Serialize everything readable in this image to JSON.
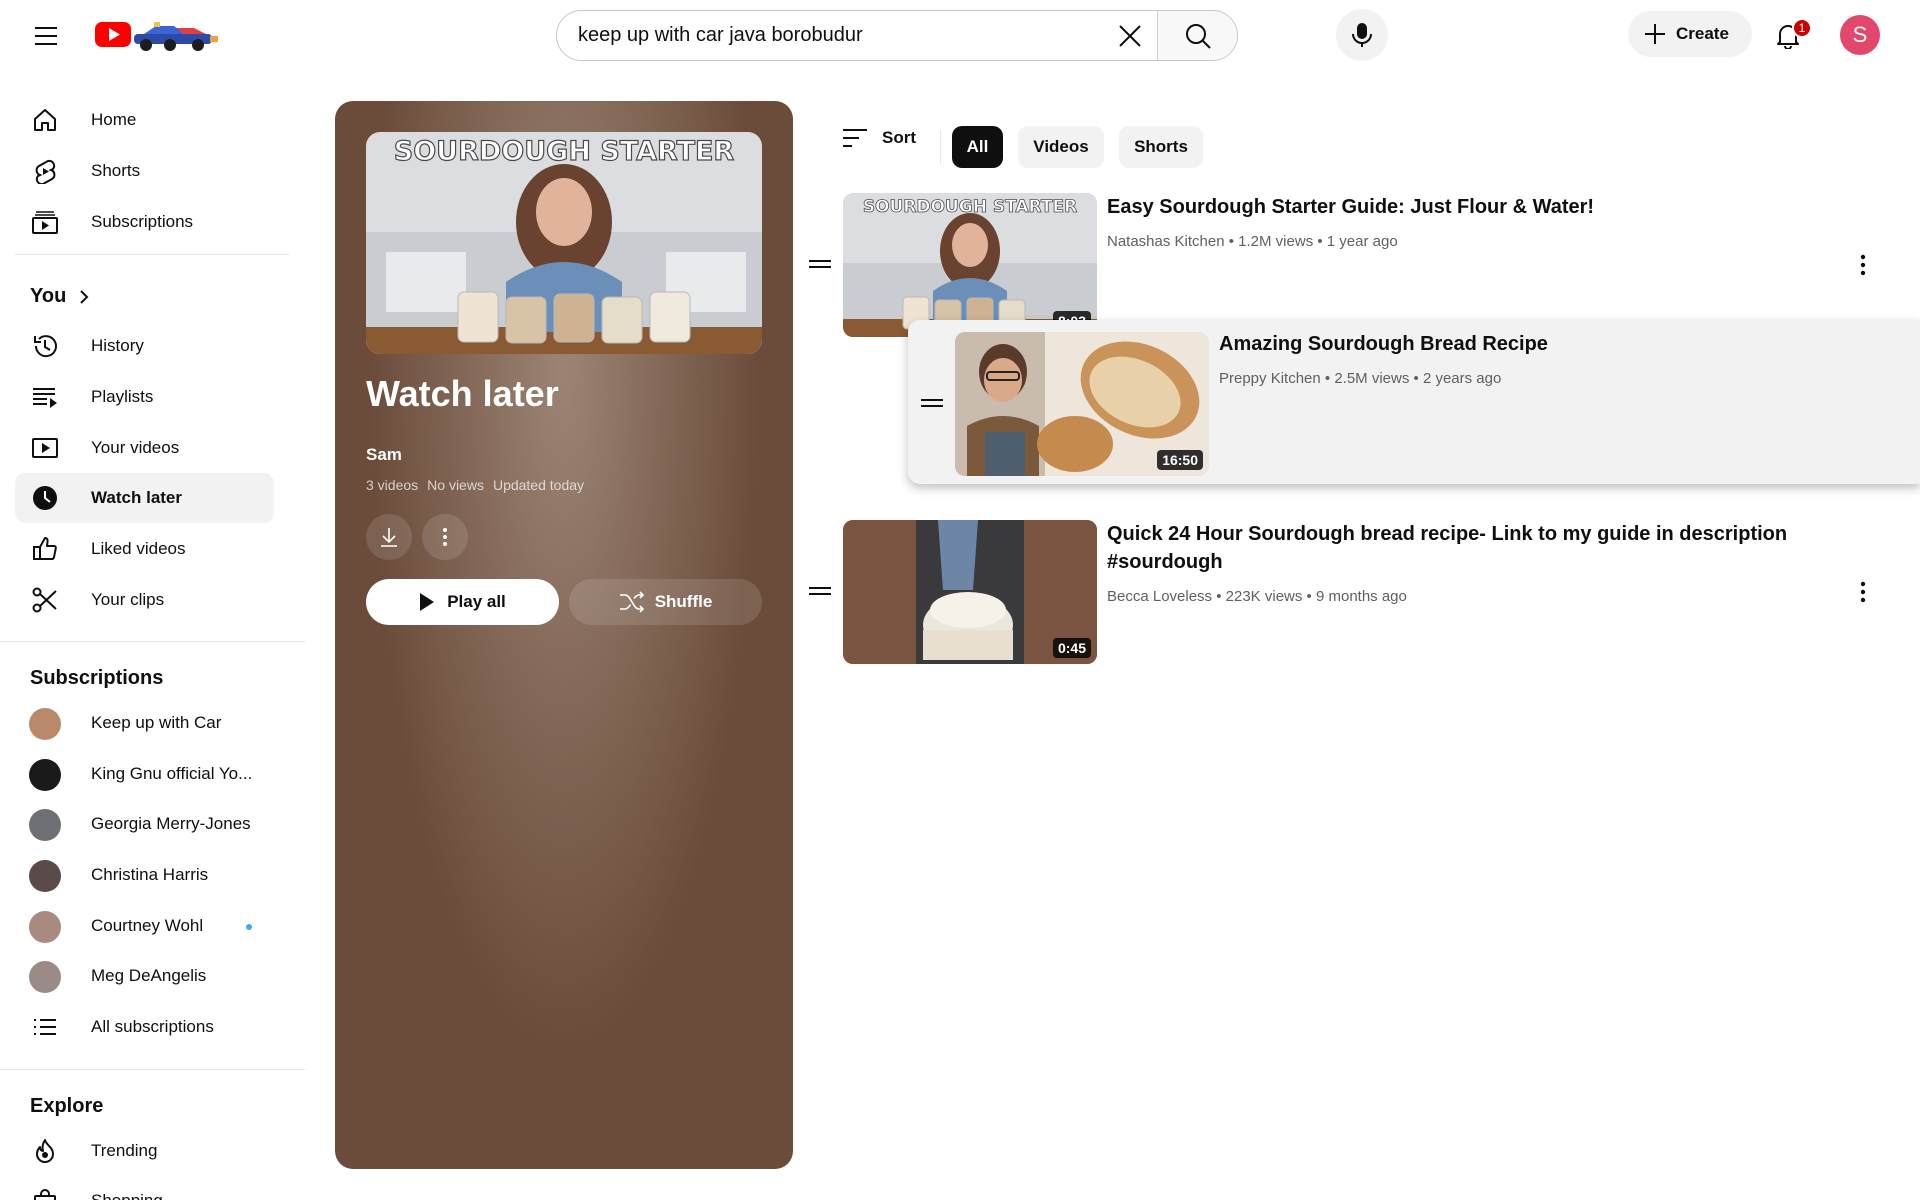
{
  "masthead": {
    "search_value": "keep up with car java borobudur",
    "create_label": "Create",
    "notification_count": "1",
    "avatar_letter": "S"
  },
  "sidebar": {
    "main": [
      {
        "label": "Home",
        "icon": "home-icon"
      },
      {
        "label": "Shorts",
        "icon": "shorts-icon"
      },
      {
        "label": "Subscriptions",
        "icon": "subscriptions-icon"
      }
    ],
    "you_title": "You",
    "you_items": [
      {
        "label": "History",
        "icon": "history-icon"
      },
      {
        "label": "Playlists",
        "icon": "playlists-icon"
      },
      {
        "label": "Your videos",
        "icon": "your-videos-icon"
      },
      {
        "label": "Watch later",
        "icon": "watch-later-icon",
        "active": true
      },
      {
        "label": "Liked videos",
        "icon": "like-icon"
      },
      {
        "label": "Your clips",
        "icon": "scissors-icon"
      }
    ],
    "subscriptions_title": "Subscriptions",
    "subscriptions": [
      {
        "label": "Keep up with Car",
        "color": "#b98a6a"
      },
      {
        "label": "King Gnu official Yo...",
        "color": "#1a1a1a"
      },
      {
        "label": "Georgia Merry-Jones",
        "color": "#6d6f74"
      },
      {
        "label": "Christina Harris",
        "color": "#5a4a48"
      },
      {
        "label": "Courtney Wohl",
        "color": "#a98a80",
        "new": true
      },
      {
        "label": "Meg DeAngelis",
        "color": "#9b8b86"
      }
    ],
    "all_subscriptions": "All subscriptions",
    "explore_title": "Explore",
    "explore": [
      {
        "label": "Trending",
        "icon": "trending-icon"
      },
      {
        "label": "Shopping",
        "icon": "shopping-icon"
      }
    ]
  },
  "playlist": {
    "title": "Watch later",
    "owner": "Sam",
    "video_count": "3 videos",
    "views": "No views",
    "updated": "Updated today",
    "play_all": "Play all",
    "shuffle": "Shuffle",
    "thumb_text": "SOURDOUGH STARTER"
  },
  "filters": {
    "sort_label": "Sort",
    "chips": [
      "All",
      "Videos",
      "Shorts"
    ],
    "selected": "All"
  },
  "videos": [
    {
      "title": "Easy Sourdough Starter Guide: Just Flour & Water!",
      "channel": "Natashas Kitchen",
      "views": "1.2M views",
      "age": "1 year ago",
      "duration": "8:03",
      "thumb_text": "SOURDOUGH STARTER"
    },
    {
      "title": "Amazing Sourdough Bread Recipe",
      "channel": "Preppy Kitchen",
      "views": "2.5M views",
      "age": "2 years ago",
      "duration": "16:50"
    },
    {
      "title": "Quick 24 Hour Sourdough bread recipe- Link to my guide in description #sourdough",
      "channel": "Becca Loveless",
      "views": "223K views",
      "age": "9 months ago",
      "duration": "0:45"
    }
  ]
}
